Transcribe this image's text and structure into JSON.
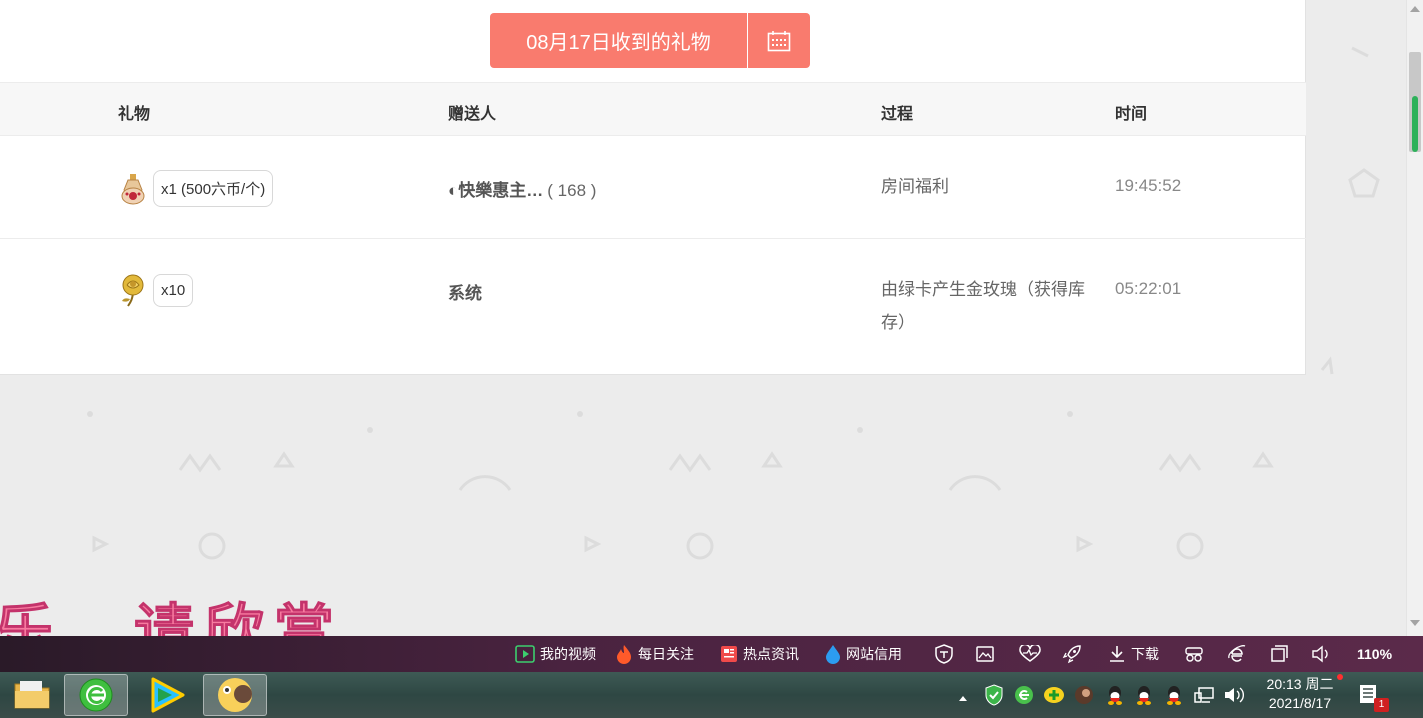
{
  "header": {
    "date_button_label": "08月17日收到的礼物",
    "calendar_icon": "calendar-icon"
  },
  "table": {
    "columns": [
      "礼物",
      "赠送人",
      "过程",
      "时间"
    ],
    "rows": [
      {
        "gift_icon": "perfume-bottle-icon",
        "quantity": "x1 (500六币/个)",
        "sender": "◐快樂惠主…",
        "sender_count": "( 168 )",
        "process": "房间福利",
        "time": "19:45:52"
      },
      {
        "gift_icon": "golden-rose-icon",
        "quantity": "x10",
        "sender": "系统",
        "sender_count": "",
        "process": "由绿卡产生金玫瑰（获得库存）",
        "time": "05:22:01"
      }
    ]
  },
  "overlay": {
    "caption": "乐，请欣赏"
  },
  "statusbar": {
    "my_videos": "我的视频",
    "daily_follow": "每日关注",
    "hot_news": "热点资讯",
    "site_credit": "网站信用",
    "download": "下载",
    "zoom": "110%"
  },
  "taskbar": {
    "clock_time": "20:13 周二",
    "clock_date": "2021/8/17",
    "notification_count": "1"
  },
  "colors": {
    "accent": "#f97b6e",
    "status_bar": "#4a2340",
    "taskbar": "#2e4743"
  }
}
